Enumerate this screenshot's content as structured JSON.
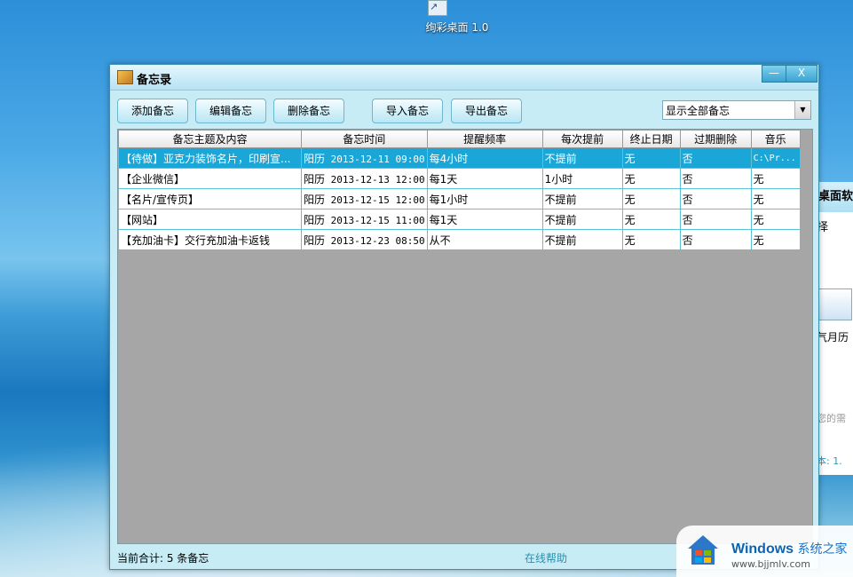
{
  "desktop": {
    "icon_label": "绚彩桌面 1.0"
  },
  "bg_window": {
    "title": "桌面软",
    "tab": "择",
    "cal_label": "气月历",
    "hint": "您的需",
    "version": "本: 1."
  },
  "window": {
    "title": "备忘录",
    "minimize": "—",
    "close": "X"
  },
  "toolbar": {
    "add": "添加备忘",
    "edit": "编辑备忘",
    "delete": "删除备忘",
    "import": "导入备忘",
    "export": "导出备忘",
    "filter_value": "显示全部备忘"
  },
  "table": {
    "columns": [
      "备忘主题及内容",
      "备忘时间",
      "提醒频率",
      "每次提前",
      "终止日期",
      "过期删除",
      "音乐"
    ],
    "rows": [
      {
        "subject": "【待做】亚克力装饰名片，印刷宣...",
        "cal": "阳历",
        "time": "2013-12-11 09:00",
        "freq": "每4小时",
        "advance": "不提前",
        "end": "无",
        "expire": "否",
        "music": "C:\\Pr..."
      },
      {
        "subject": "【企业微信】",
        "cal": "阳历",
        "time": "2013-12-13 12:00",
        "freq": "每1天",
        "advance": "1小时",
        "end": "无",
        "expire": "否",
        "music": "无"
      },
      {
        "subject": "【名片/宣传页】",
        "cal": "阳历",
        "time": "2013-12-15 12:00",
        "freq": "每1小时",
        "advance": "不提前",
        "end": "无",
        "expire": "否",
        "music": "无"
      },
      {
        "subject": "【网站】",
        "cal": "阳历",
        "time": "2013-12-15 11:00",
        "freq": "每1天",
        "advance": "不提前",
        "end": "无",
        "expire": "否",
        "music": "无"
      },
      {
        "subject": "【充加油卡】交行充加油卡返钱",
        "cal": "阳历",
        "time": "2013-12-23 08:50",
        "freq": "从不",
        "advance": "不提前",
        "end": "无",
        "expire": "否",
        "music": "无"
      }
    ],
    "selected_row": 0
  },
  "status": {
    "count": "当前合计: 5 条备忘",
    "help": "在线帮助"
  },
  "watermark": {
    "brand": "Windows",
    "brand_suffix": "系统之家",
    "url": "www.bjjmlv.com"
  }
}
